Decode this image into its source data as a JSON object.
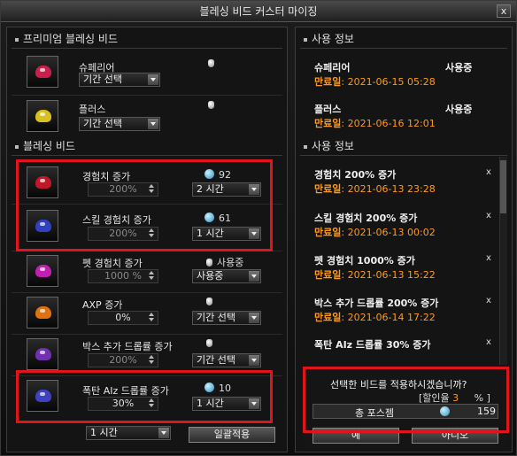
{
  "window": {
    "title": "블레싱 비드 커스터 마이징",
    "close_label": "x"
  },
  "premium": {
    "header": "프리미엄 블레싱 비드",
    "items": [
      {
        "name": "슈페리어",
        "period": "기간 선택",
        "icon": "superior-bead-icon",
        "color": "#c8204a"
      },
      {
        "name": "플러스",
        "period": "기간 선택",
        "icon": "plus-bead-icon",
        "color": "#d8c020"
      }
    ]
  },
  "blessing": {
    "header": "블레싱 비드",
    "items": [
      {
        "name": "경험치 증가",
        "pct": "200%",
        "cost": "92",
        "period": "2 시간",
        "icon": "exp-bead-icon",
        "color": "#c01828",
        "active": false
      },
      {
        "name": "스킬 경험치 증가",
        "pct": "200%",
        "cost": "61",
        "period": "1 시간",
        "icon": "skill-exp-bead-icon",
        "color": "#3040c0",
        "active": false
      },
      {
        "name": "펫 경험치 증가",
        "pct": "1000 %",
        "cost": "사용중",
        "period": "사용중",
        "icon": "pet-exp-bead-icon",
        "color": "#c020b0",
        "active": false
      },
      {
        "name": "AXP 증가",
        "pct": "0%",
        "cost": "",
        "period": "기간 선택",
        "icon": "axp-bead-icon",
        "color": "#e07010",
        "active": true
      },
      {
        "name": "박스 추가 드롭률 증가",
        "pct": "200%",
        "cost": "",
        "period": "기간 선택",
        "icon": "box-drop-bead-icon",
        "color": "#7030b0",
        "active": false
      },
      {
        "name": "폭탄 AIz 드롭률 증가",
        "pct": "30%",
        "cost": "10",
        "period": "1 시간",
        "icon": "bomb-drop-bead-icon",
        "color": "#4040c0",
        "active": true
      }
    ],
    "bulk_period": "1 시간",
    "bulk_apply": "일괄적용"
  },
  "premium_info": {
    "header": "사용 정보",
    "items": [
      {
        "name": "슈페리어",
        "status": "사용중",
        "exp_label": "만료일",
        "exp_date": ": 2021-06-15 05:28"
      },
      {
        "name": "플러스",
        "status": "사용중",
        "exp_label": "만료일",
        "exp_date": ": 2021-06-16 12:01"
      }
    ]
  },
  "bead_info": {
    "header": "사용 정보",
    "items": [
      {
        "name": "경험치 200% 증가",
        "exp_label": "만료일",
        "exp_date": ": 2021-06-13 23:28"
      },
      {
        "name": "스킬 경험치 200% 증가",
        "exp_label": "만료일",
        "exp_date": ": 2021-06-13 00:02"
      },
      {
        "name": "펫 경험치 1000% 증가",
        "exp_label": "만료일",
        "exp_date": ": 2021-06-13 15:22"
      },
      {
        "name": "박스 추가 드롭률 200% 증가",
        "exp_label": "만료일",
        "exp_date": ": 2021-06-14 17:22"
      },
      {
        "name": "폭탄 AIz 드롭률 30% 증가",
        "exp_label": "",
        "exp_date": ""
      }
    ],
    "remove_label": "x"
  },
  "confirm": {
    "question": "선택한 비드를 적용하시겠습니까?",
    "discount_label": "[할인율",
    "discount_value": "3",
    "discount_unit": "% ]",
    "total_label": "총 포스젬",
    "total_value": "159",
    "yes": "예",
    "no": "아니오"
  },
  "colors": {
    "highlight": "#e0141b",
    "expire": "#ff9a1a"
  }
}
